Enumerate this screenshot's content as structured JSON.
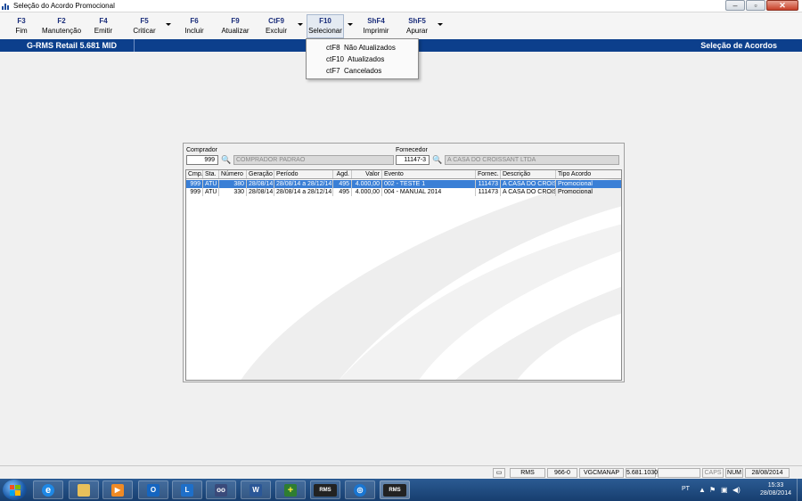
{
  "window": {
    "title": "Seleção do Acordo Promocional",
    "controls": {
      "minimize": "–",
      "maximize": "▫",
      "close": "✕"
    }
  },
  "toolbar": {
    "buttons": [
      {
        "key": "F3",
        "label": "Fim"
      },
      {
        "key": "F2",
        "label": "Manutenção"
      },
      {
        "key": "F4",
        "label": "Emitir"
      },
      {
        "key": "F5",
        "label": "Criticar"
      },
      {
        "key": "F6",
        "label": "Incluir"
      },
      {
        "key": "F9",
        "label": "Atualizar"
      },
      {
        "key": "CtF9",
        "label": "Excluir"
      },
      {
        "key": "F10",
        "label": "Selecionar"
      },
      {
        "key": "ShF4",
        "label": "Imprimir"
      },
      {
        "key": "ShF5",
        "label": "Apurar"
      }
    ]
  },
  "header": {
    "system": "G-RMS Retail 5.681 MID",
    "screen": "Seleção de Acordos"
  },
  "dropdown": {
    "items": [
      {
        "shortcut": "ctF8",
        "label": "Não Atualizados"
      },
      {
        "shortcut": "ctF10",
        "label": "Atualizados"
      },
      {
        "shortcut": "ctF7",
        "label": "Cancelados"
      }
    ]
  },
  "filters": {
    "comprador_label": "Comprador",
    "comprador_code": "999",
    "comprador_name": "COMPRADOR PADRAO",
    "fornecedor_label": "Fornecedor",
    "fornecedor_code": "11147-3",
    "fornecedor_name": "A CASA DO CROISSANT LTDA"
  },
  "table": {
    "columns": [
      "Cmp.",
      "Sta.",
      "Número",
      "Geração",
      "Período",
      "Agd.",
      "Valor",
      "Evento",
      "Fornec.",
      "Descrição",
      "Tipo Acordo"
    ],
    "rows": [
      [
        "999",
        "ATU",
        "380",
        "28/08/14",
        "28/08/14 a 28/12/14",
        "495",
        "4.000,00",
        "002 -  TESTE 1",
        "111473",
        "A CASA DO CROISS",
        "Promocional"
      ],
      [
        "999",
        "ATU",
        "330",
        "28/08/14",
        "28/08/14 a 28/12/14",
        "495",
        "4.000,00",
        "004 -  MANUAL 2014",
        "111473",
        "A CASA DO CROISS",
        "Promocional"
      ]
    ],
    "selected_row": 0
  },
  "statusbar": {
    "cells": [
      "RMS",
      "966-0",
      "VGCMANAP",
      "5.681.1030",
      "",
      "CAPS",
      "NUM",
      "28/08/2014"
    ]
  },
  "taskbar": {
    "apps": [
      {
        "name": "ie",
        "text": "e"
      },
      {
        "name": "explorer",
        "text": ""
      },
      {
        "name": "media",
        "text": "▶"
      },
      {
        "name": "outlook",
        "text": "O"
      },
      {
        "name": "lync",
        "text": "L"
      },
      {
        "name": "app-oo",
        "text": "oo"
      },
      {
        "name": "word",
        "text": "W"
      },
      {
        "name": "app-plus",
        "text": "+"
      },
      {
        "name": "rms-1",
        "text": "RMS"
      },
      {
        "name": "app-globe",
        "text": "◎"
      },
      {
        "name": "rms-2",
        "text": "RMS"
      }
    ],
    "lang": "PT",
    "time": "15:33",
    "date": "28/08/2014"
  },
  "colors": {
    "accent": "#0c3f8c",
    "selection": "#3a7fd6"
  }
}
